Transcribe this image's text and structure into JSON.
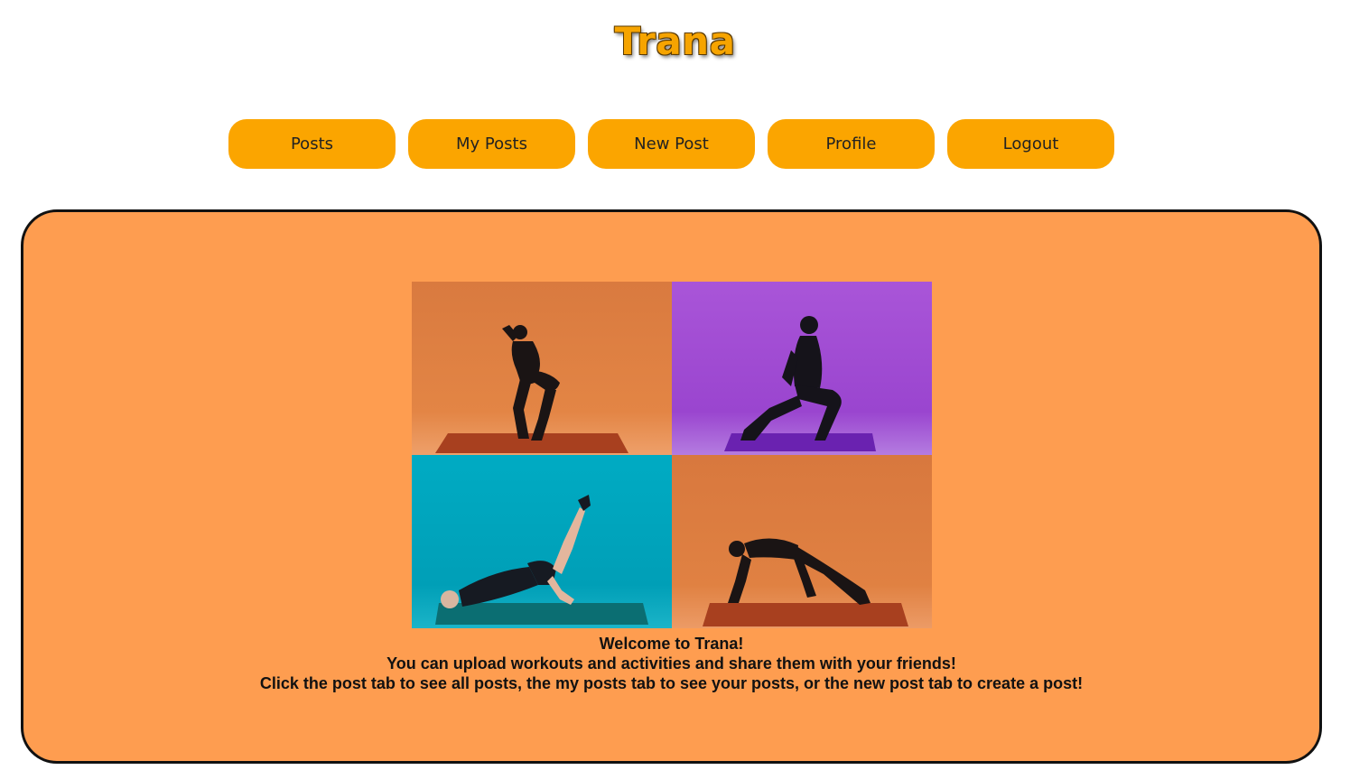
{
  "header": {
    "title": "Trana"
  },
  "nav": {
    "items": [
      {
        "label": "Posts"
      },
      {
        "label": "My Posts"
      },
      {
        "label": "New Post"
      },
      {
        "label": "Profile"
      },
      {
        "label": "Logout"
      }
    ]
  },
  "main": {
    "welcome_line1": "Welcome to Trana!",
    "welcome_line2": "You can upload workouts and activities and share them with your friends!",
    "welcome_line3": "Click the post tab to see all posts, the my posts tab to see your posts, or the new post tab to create a post!"
  },
  "colors": {
    "title": "#f6a400",
    "button": "#fba500",
    "panel": "#fe9d50",
    "panel_border": "#111111",
    "tile_orange": "#d9773c",
    "tile_purple": "#a552d6",
    "tile_teal": "#00a9c2",
    "tile_orange_2": "#d87438"
  }
}
